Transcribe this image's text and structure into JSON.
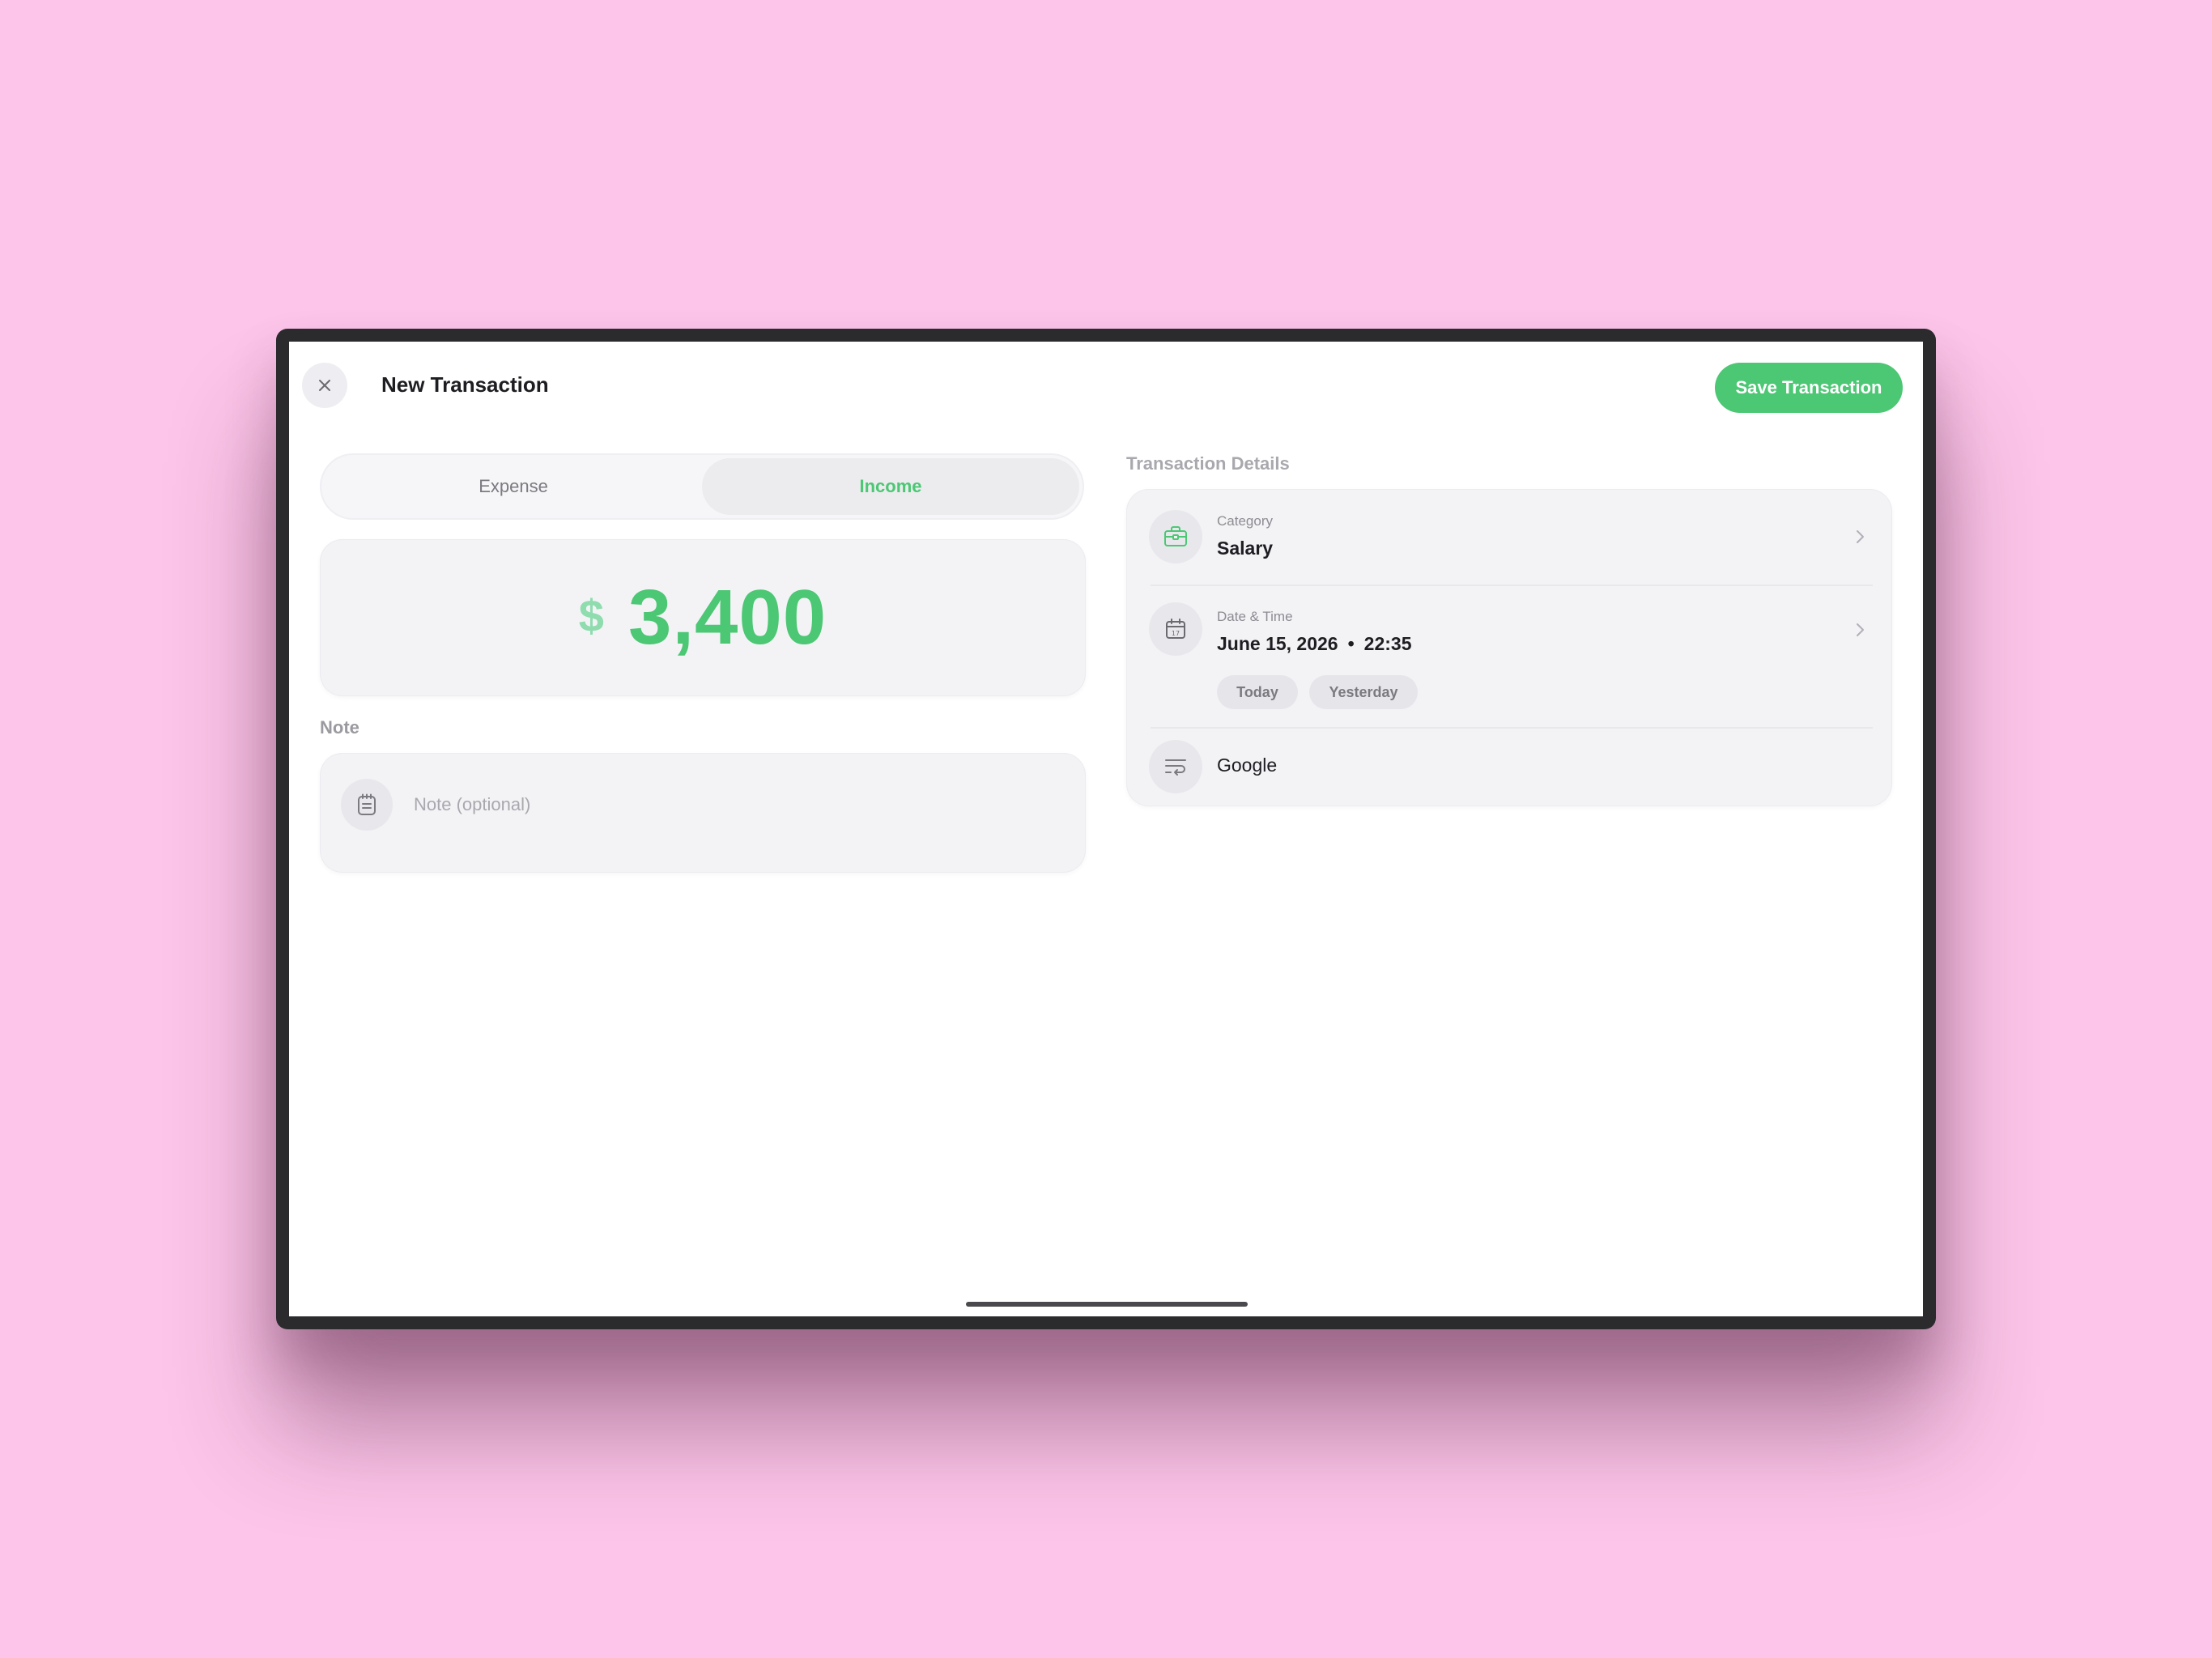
{
  "header": {
    "title": "New Transaction",
    "save_label": "Save Transaction",
    "close_icon": "close-icon"
  },
  "type_toggle": {
    "options": [
      {
        "label": "Expense",
        "selected": false
      },
      {
        "label": "Income",
        "selected": true
      }
    ]
  },
  "amount": {
    "currency_symbol": "$",
    "value": "3,400"
  },
  "note": {
    "section_label": "Note",
    "placeholder": "Note (optional)",
    "value": "",
    "icon": "note-icon"
  },
  "details": {
    "section_label": "Transaction Details",
    "category": {
      "label": "Category",
      "value": "Salary",
      "icon": "briefcase-icon"
    },
    "datetime": {
      "label": "Date & Time",
      "date": "June 15, 2026",
      "separator": "•",
      "time": "22:35",
      "icon": "calendar-icon",
      "quick_picks": [
        "Today",
        "Yesterday"
      ]
    },
    "payee": {
      "value": "Google",
      "icon": "payee-icon"
    }
  },
  "colors": {
    "accent": "#4cc774",
    "background": "#fcc5e9"
  }
}
